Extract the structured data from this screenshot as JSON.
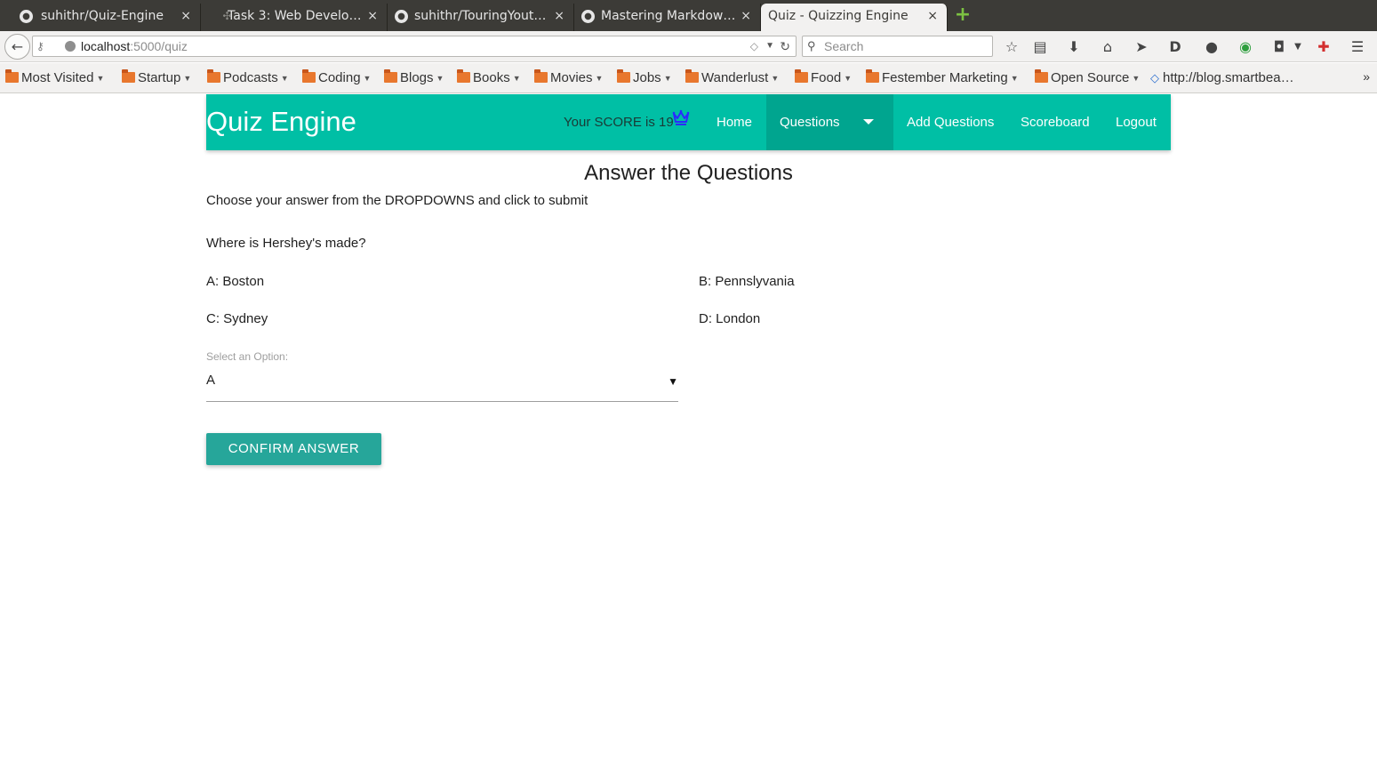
{
  "browser": {
    "tabs": [
      {
        "title": "suhithr/Quiz-Engine",
        "favicon": "github-icon",
        "active": false
      },
      {
        "title": "Task 3: Web Develo…",
        "favicon": "page-icon",
        "active": false
      },
      {
        "title": "suhithr/TouringYout…",
        "favicon": "github-icon",
        "active": false
      },
      {
        "title": "Mastering Markdow…",
        "favicon": "github-icon",
        "active": false
      },
      {
        "title": "Quiz - Quizzing Engine",
        "favicon": "page-icon",
        "active": true
      }
    ],
    "close_glyph": "×",
    "url_host": "localhost",
    "url_path": ":5000/quiz",
    "search_placeholder": "Search",
    "bookmarks": [
      {
        "label": "Most Visited"
      },
      {
        "label": "Startup"
      },
      {
        "label": "Podcasts"
      },
      {
        "label": "Coding"
      },
      {
        "label": "Blogs"
      },
      {
        "label": "Books"
      },
      {
        "label": "Movies"
      },
      {
        "label": "Jobs"
      },
      {
        "label": "Wanderlust"
      },
      {
        "label": "Food"
      },
      {
        "label": "Festember Marketing"
      },
      {
        "label": "Open Source"
      }
    ],
    "bookmark_link": "http://blog.smartbea…"
  },
  "header": {
    "brand": "Quiz Engine",
    "score_text": "Your SCORE is 19",
    "crown_color": "#2b2bff",
    "nav": {
      "home": "Home",
      "questions": "Questions",
      "add_questions": "Add Questions",
      "scoreboard": "Scoreboard",
      "logout": "Logout"
    }
  },
  "main": {
    "title": "Answer the Questions",
    "instructions": "Choose your answer from the DROPDOWNS and click to submit",
    "question": "Where is Hershey's made?",
    "options": {
      "a": "A: Boston",
      "b": "B: Pennslyvania",
      "c": "C: Sydney",
      "d": "D: London"
    },
    "select_label": "Select an Option:",
    "selected_value": "A",
    "confirm_label": "CONFIRM ANSWER"
  },
  "colors": {
    "header_bg": "#00bfa5",
    "active_nav_bg": "#00a58f",
    "button_bg": "#26a69a"
  }
}
